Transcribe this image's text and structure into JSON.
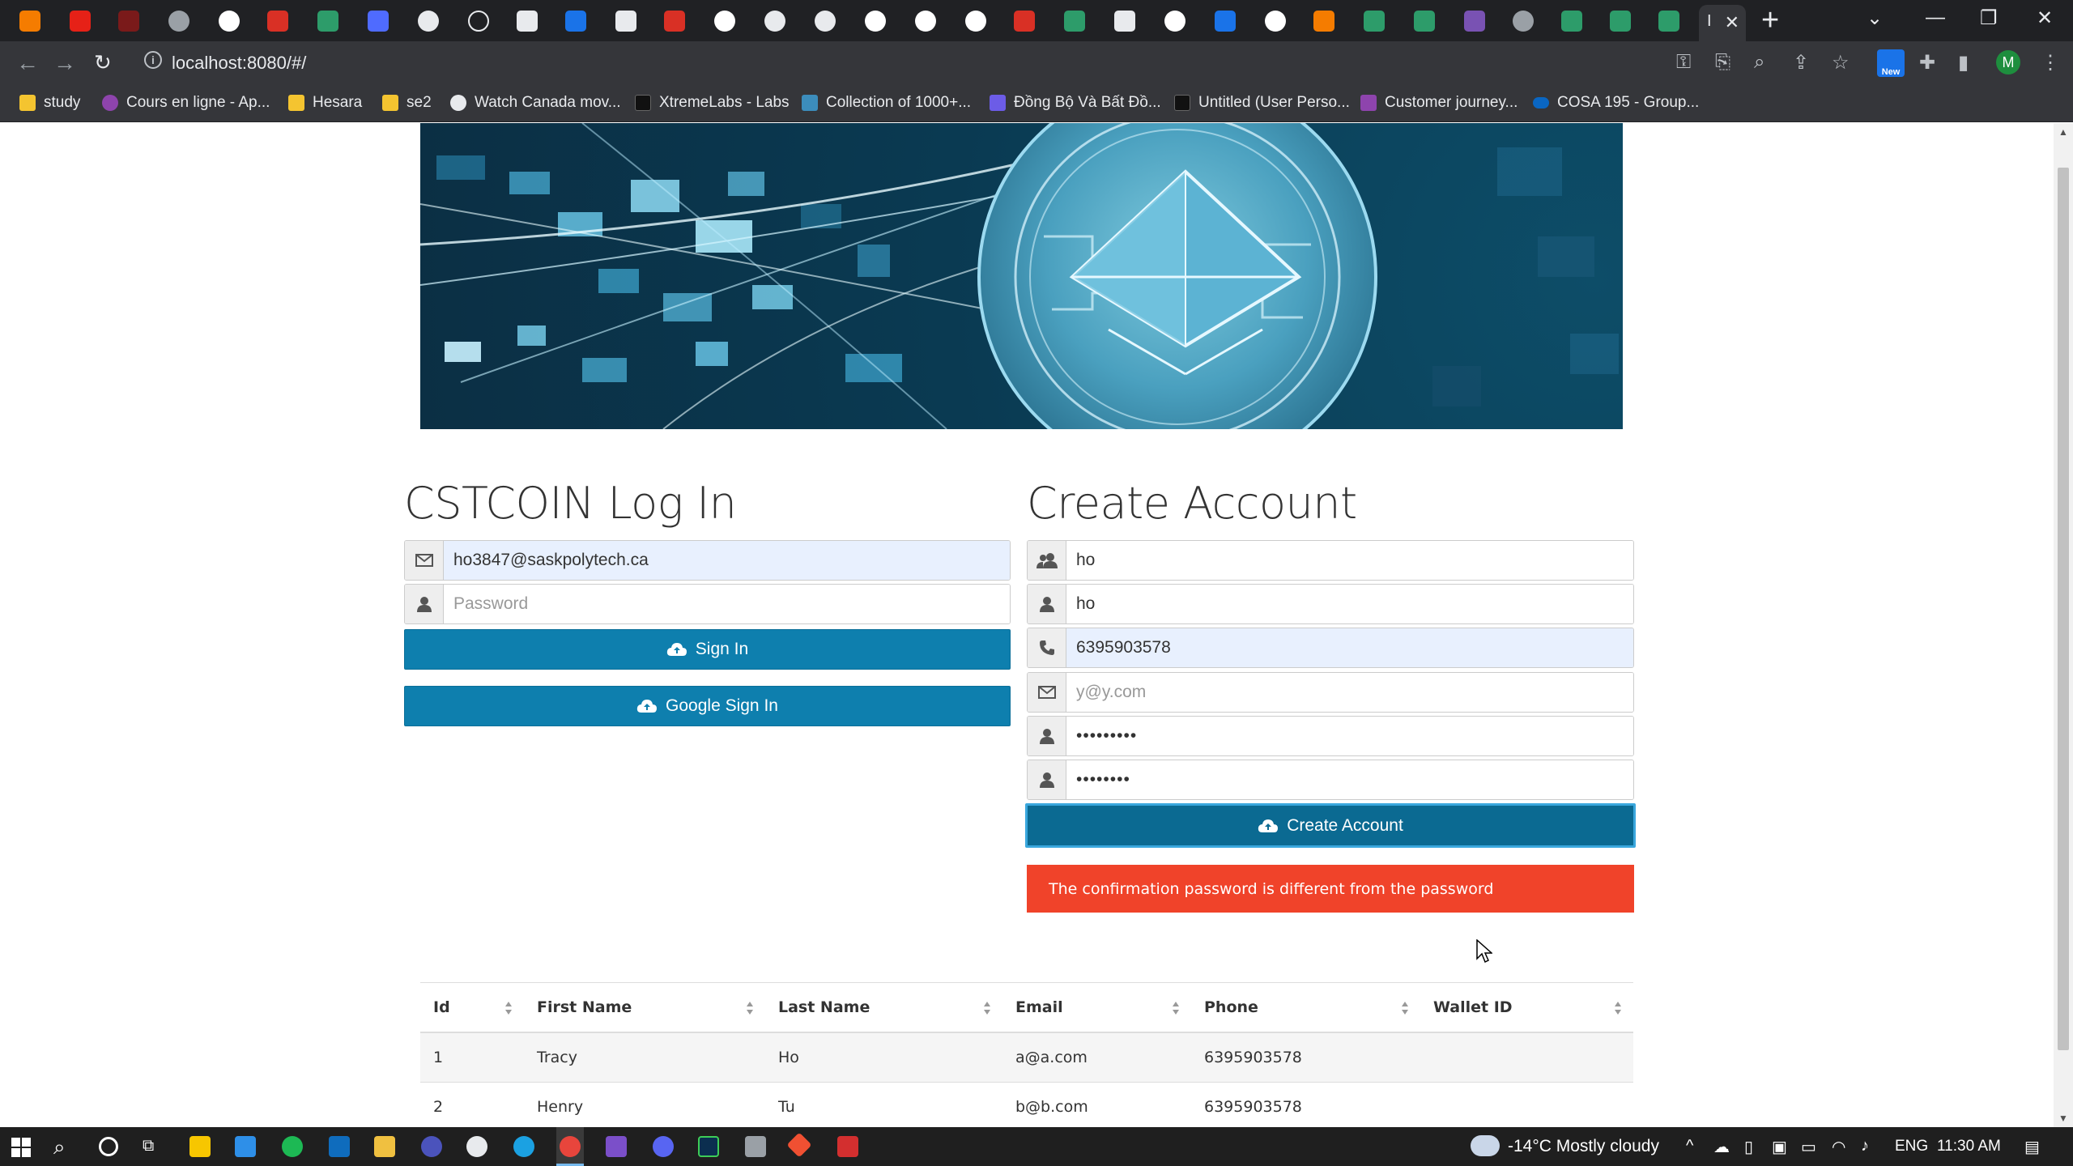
{
  "browser": {
    "url": "localhost:8080/#/",
    "active_tab_short": "I",
    "profile_initial": "M",
    "ext_badge": "New"
  },
  "bookmarks": [
    {
      "label": "study",
      "color": "#f4c430"
    },
    {
      "label": "Cours en ligne - Ap...",
      "color": "#8e44ad"
    },
    {
      "label": "Hesara",
      "color": "#f4c430"
    },
    {
      "label": "se2",
      "color": "#f4c430"
    },
    {
      "label": "Watch Canada mov...",
      "color": "#e8eaed"
    },
    {
      "label": "XtremeLabs - Labs",
      "color": "#111111"
    },
    {
      "label": "Collection of 1000+...",
      "color": "#3c8dbc"
    },
    {
      "label": "Đồng Bộ Và Bất Đồ...",
      "color": "#6c5ce7"
    },
    {
      "label": "Untitled (User Perso...",
      "color": "#111111"
    },
    {
      "label": "Customer journey...",
      "color": "#8e44ad"
    },
    {
      "label": "COSA 195 - Group...",
      "color": "#0a66c2"
    }
  ],
  "login": {
    "title": "CSTCOIN Log In",
    "email_value": "ho3847@saskpolytech.ca",
    "password_placeholder": "Password",
    "sign_in_label": "Sign In",
    "google_sign_in_label": "Google Sign In"
  },
  "create": {
    "title": "Create Account",
    "first_name_value": "ho",
    "last_name_value": "ho",
    "phone_value": "6395903578",
    "email_placeholder": "y@y.com",
    "password_value": "•••••••••",
    "confirm_value": "••••••••",
    "button_label": "Create Account",
    "error": "The confirmation password is different from the password"
  },
  "table": {
    "headers": [
      "Id",
      "First Name",
      "Last Name",
      "Email",
      "Phone",
      "Wallet ID"
    ],
    "rows": [
      [
        "1",
        "Tracy",
        "Ho",
        "a@a.com",
        "6395903578",
        ""
      ],
      [
        "2",
        "Henry",
        "Tu",
        "b@b.com",
        "6395903578",
        ""
      ]
    ]
  },
  "taskbar": {
    "weather": "-14°C  Mostly cloudy",
    "lang": "ENG",
    "time": "11:30 AM"
  },
  "colors": {
    "primary_button": "#0e7fae",
    "alert": "#f0432a",
    "autofill": "#e8f0fe"
  }
}
